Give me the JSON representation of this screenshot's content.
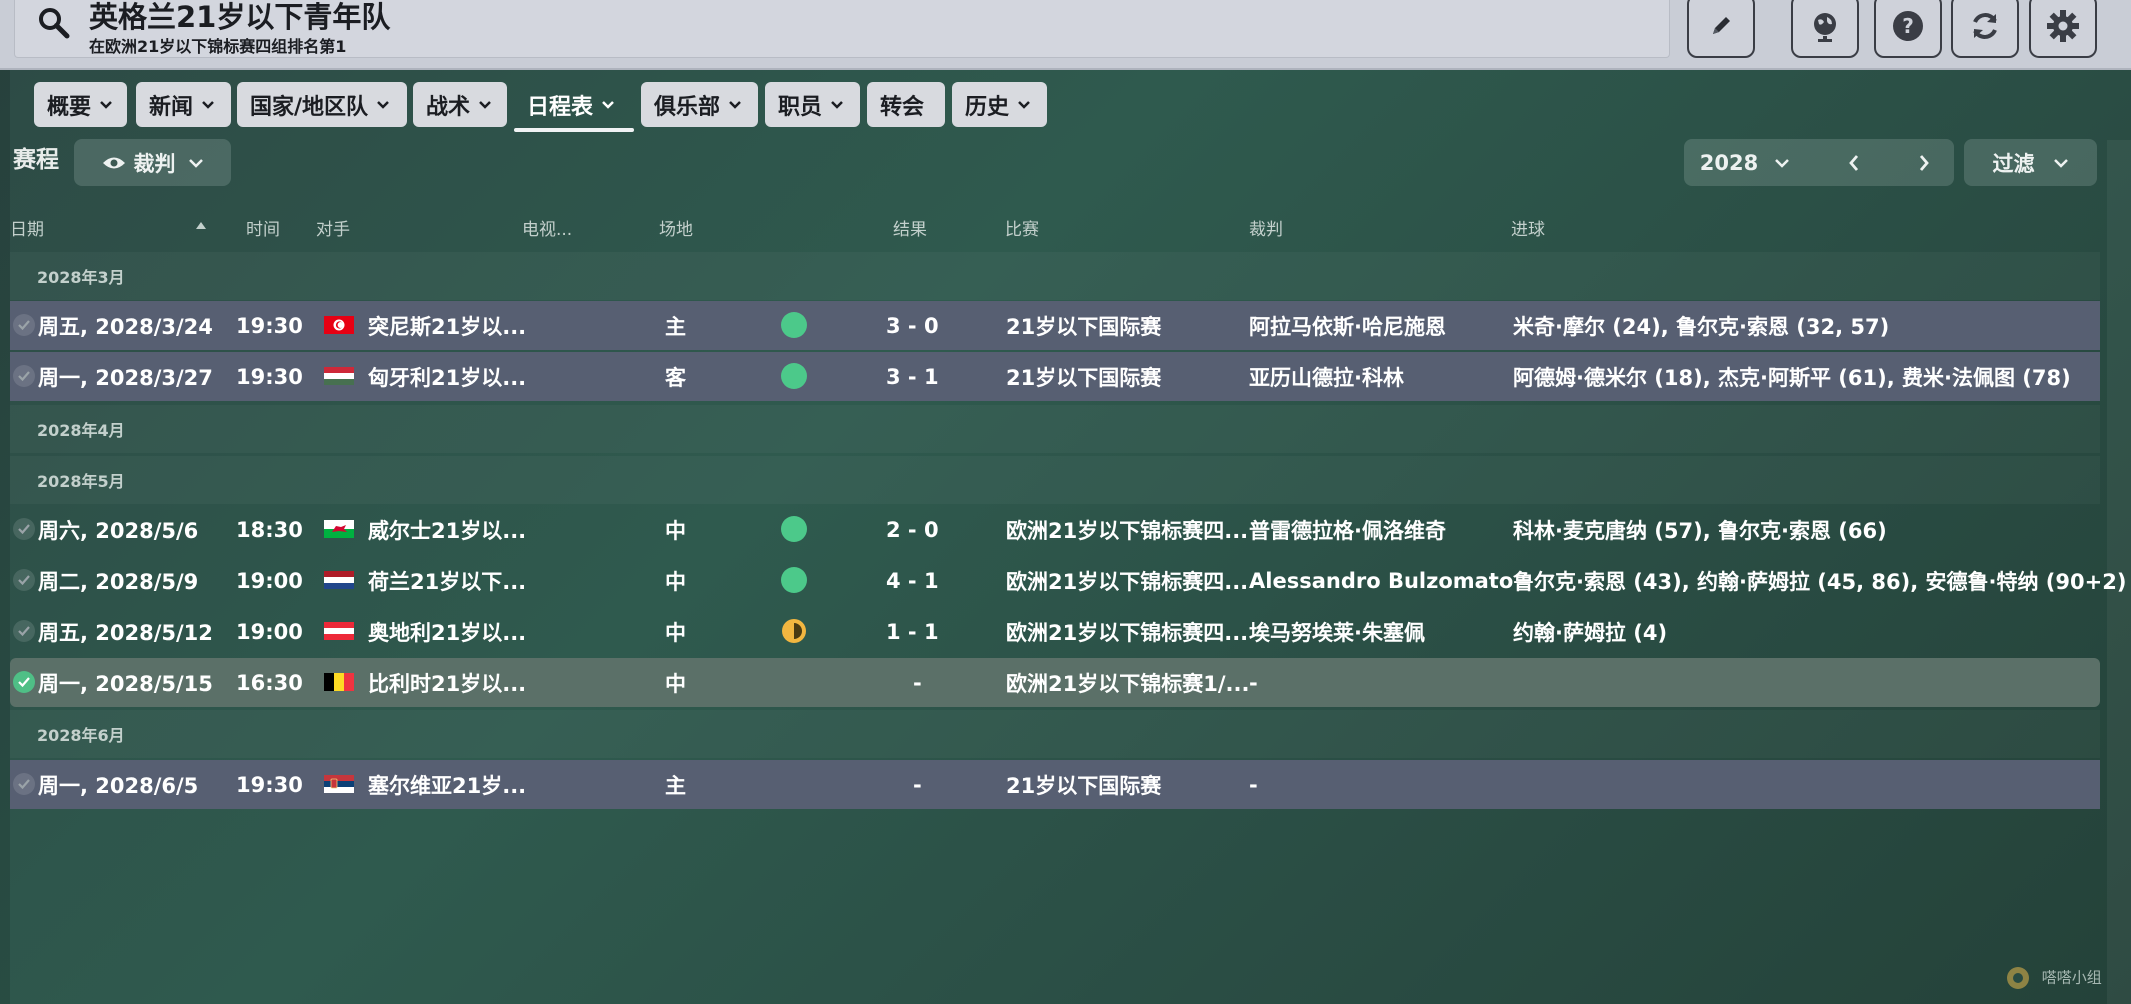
{
  "header": {
    "title": "英格兰21岁以下青年队",
    "subtitle": "在欧洲21岁以下锦标赛四组排名第1",
    "icons": [
      "edit-icon",
      "globe-icon",
      "help-icon",
      "refresh-icon",
      "settings-icon"
    ]
  },
  "nav": {
    "tabs": [
      {
        "label": "概要"
      },
      {
        "label": "新闻"
      },
      {
        "label": "国家/地区队"
      },
      {
        "label": "战术"
      },
      {
        "label": "日程表"
      },
      {
        "label": "俱乐部"
      },
      {
        "label": "职员"
      },
      {
        "label": "转会"
      },
      {
        "label": "历史"
      }
    ],
    "active": "日程表"
  },
  "toolbar": {
    "section_label": "赛程",
    "view_label": "裁判",
    "year": "2028",
    "filter_label": "过滤"
  },
  "columns": {
    "date": "日期",
    "time": "时间",
    "opponent": "对手",
    "tv": "电视...",
    "venue": "场地",
    "result": "结果",
    "competition": "比赛",
    "referee": "裁判",
    "goals": "进球"
  },
  "months": [
    "2028年3月",
    "2028年4月",
    "2028年5月",
    "2028年6月"
  ],
  "matches": [
    {
      "date": "周五, 2028/3/24",
      "time": "19:30",
      "flag": "tunisia",
      "opponent": "突尼斯21岁以...",
      "venue": "主",
      "outcome": "win",
      "result": "3 - 0",
      "competition": "21岁以下国际赛",
      "referee": "阿拉马依斯·哈尼施恩",
      "goals": "米奇·摩尔 (24), 鲁尔克·索恩 (32, 57)"
    },
    {
      "date": "周一, 2028/3/27",
      "time": "19:30",
      "flag": "hungary",
      "opponent": "匈牙利21岁以...",
      "venue": "客",
      "outcome": "win",
      "result": "3 - 1",
      "competition": "21岁以下国际赛",
      "referee": "亚历山德拉·科林",
      "goals": "阿德姆·德米尔 (18), 杰克·阿斯平 (61), 费米·法佩图 (78)"
    },
    {
      "date": "周六, 2028/5/6",
      "time": "18:30",
      "flag": "wales",
      "opponent": "威尔士21岁以...",
      "venue": "中",
      "outcome": "win",
      "result": "2 - 0",
      "competition": "欧洲21岁以下锦标赛四...",
      "referee": "普雷德拉格·佩洛维奇",
      "goals": "科林·麦克唐纳 (57), 鲁尔克·索恩 (66)"
    },
    {
      "date": "周二, 2028/5/9",
      "time": "19:00",
      "flag": "netherlands",
      "opponent": "荷兰21岁以下...",
      "venue": "中",
      "outcome": "win",
      "result": "4 - 1",
      "competition": "欧洲21岁以下锦标赛四...",
      "referee": "Alessandro Bulzomato",
      "goals": "鲁尔克·索恩 (43), 约翰·萨姆拉 (45, 86), 安德鲁·特纳 (90+2)"
    },
    {
      "date": "周五, 2028/5/12",
      "time": "19:00",
      "flag": "austria",
      "opponent": "奥地利21岁以...",
      "venue": "中",
      "outcome": "draw",
      "result": "1 - 1",
      "competition": "欧洲21岁以下锦标赛四...",
      "referee": "埃马努埃莱·朱塞佩",
      "goals": "约翰·萨姆拉 (4)"
    },
    {
      "date": "周一, 2028/5/15",
      "time": "16:30",
      "flag": "belgium",
      "opponent": "比利时21岁以...",
      "venue": "中",
      "outcome": "none",
      "result": "-",
      "competition": "欧洲21岁以下锦标赛1/...",
      "referee": "-",
      "goals": ""
    },
    {
      "date": "周一, 2028/6/5",
      "time": "19:30",
      "flag": "serbia",
      "opponent": "塞尔维亚21岁...",
      "venue": "主",
      "outcome": "none",
      "result": "-",
      "competition": "21岁以下国际赛",
      "referee": "-",
      "goals": ""
    }
  ],
  "watermark": "嗒嗒小组"
}
